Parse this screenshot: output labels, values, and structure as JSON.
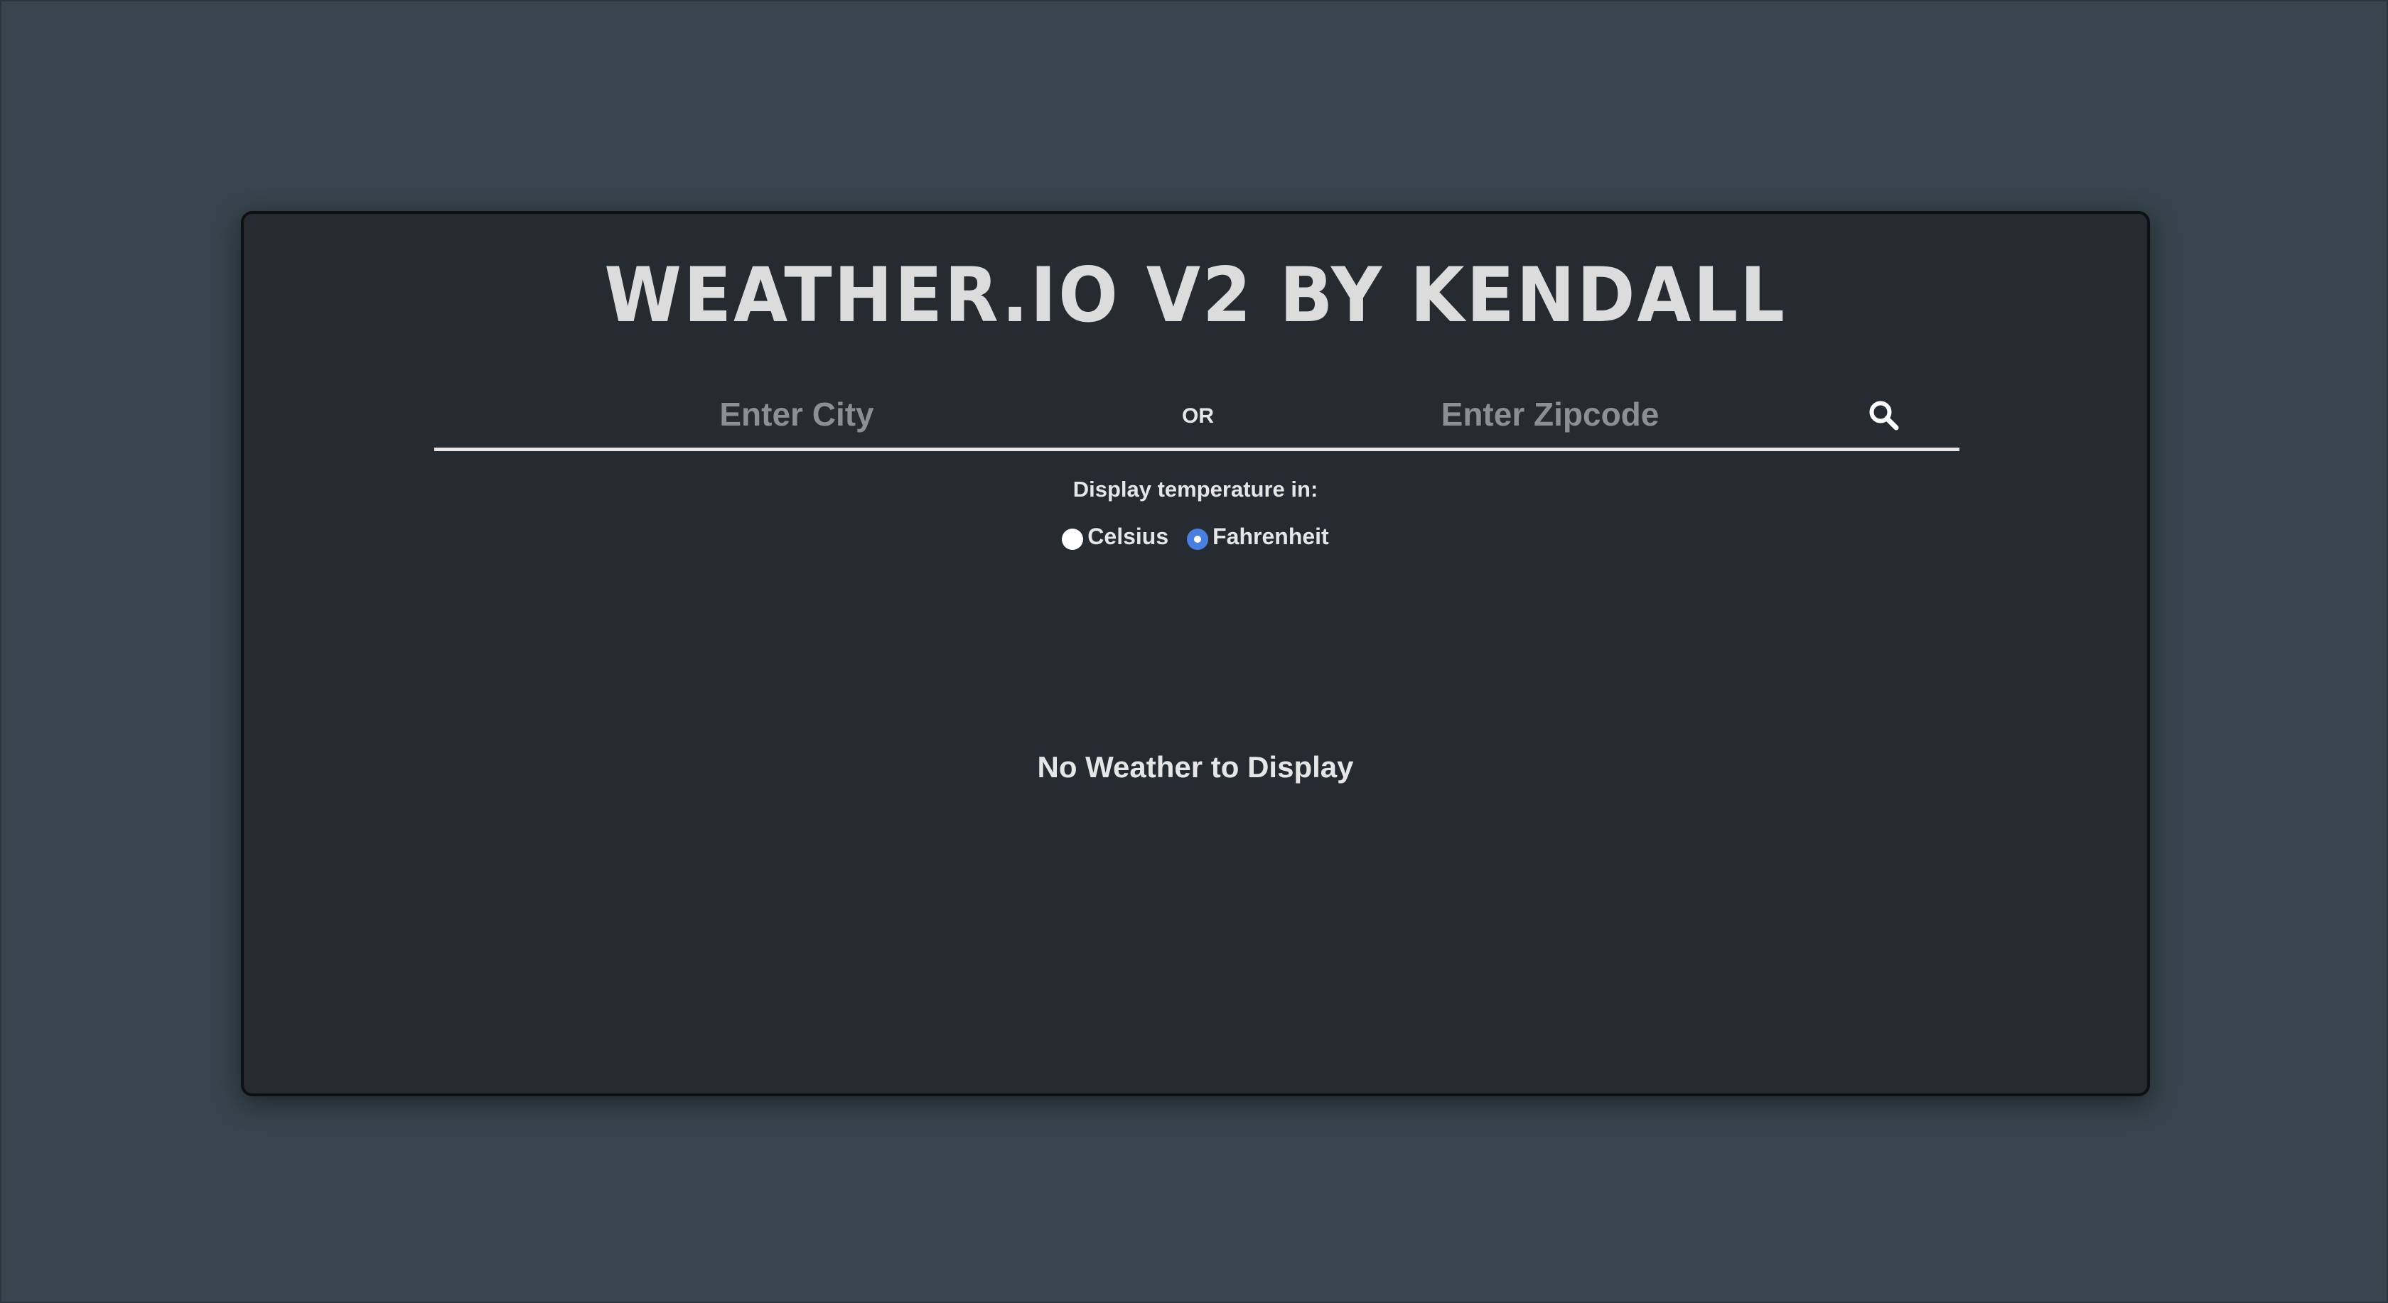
{
  "app": {
    "title": "WEATHER.IO V2 BY KENDALL"
  },
  "search": {
    "city_placeholder": "Enter City",
    "city_value": "",
    "or_label": "OR",
    "zip_placeholder": "Enter Zipcode",
    "zip_value": "",
    "button_icon": "search-icon"
  },
  "units": {
    "label": "Display temperature in:",
    "options": [
      {
        "label": "Celsius",
        "checked": false
      },
      {
        "label": "Fahrenheit",
        "checked": true
      }
    ],
    "selected": "Fahrenheit"
  },
  "result": {
    "empty_message": "No Weather to Display"
  },
  "colors": {
    "background": "#37444d",
    "card": "#262b31",
    "text": "#e6e6e6",
    "placeholder": "#8c9096",
    "accent": "#4a7fe0"
  }
}
